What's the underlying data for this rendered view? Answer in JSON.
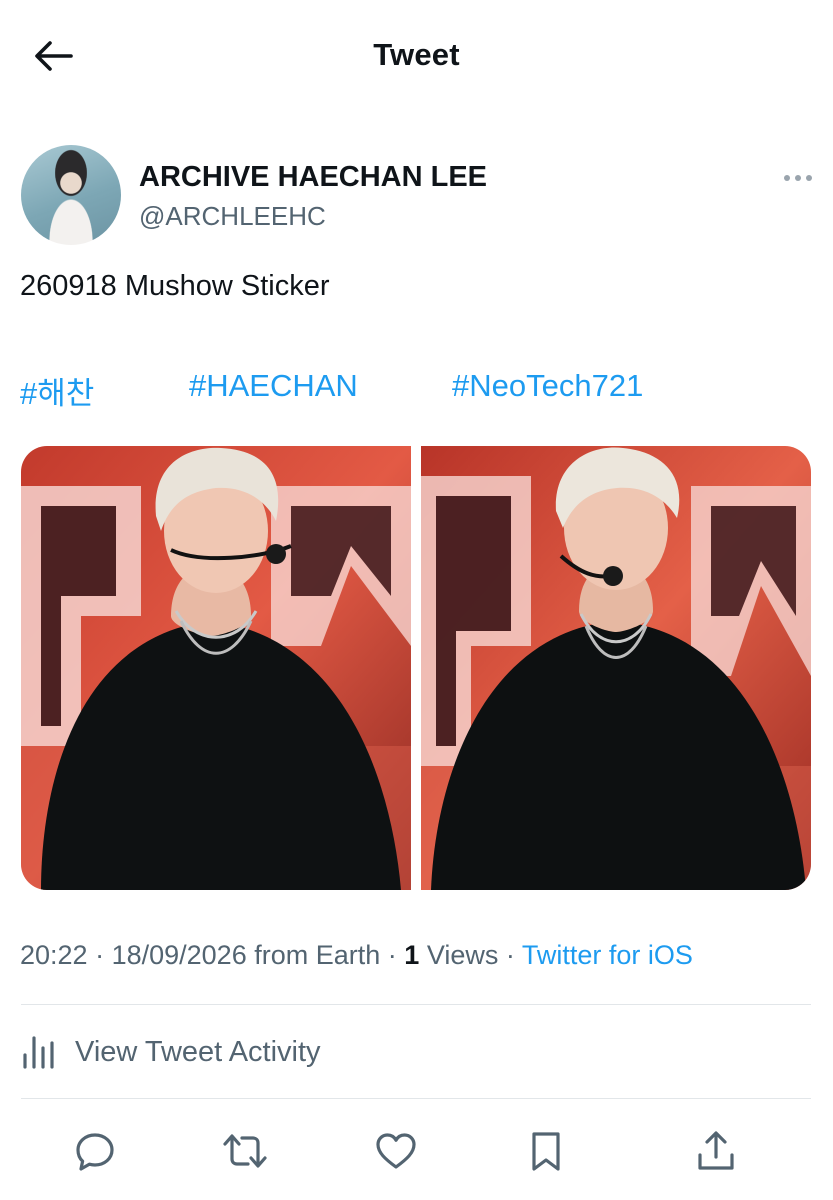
{
  "header": {
    "title": "Tweet",
    "back_icon": "arrow-left-icon"
  },
  "author": {
    "display_name": "ARCHIVE HAECHAN LEE",
    "handle": "@ARCHLEEHC",
    "more_icon": "more-horizontal-icon"
  },
  "tweet": {
    "text": "260918 Mushow Sticker",
    "hashtags": [
      "#해찬",
      "#HAECHAN",
      "#NeoTech721"
    ]
  },
  "media": {
    "count": 2
  },
  "meta": {
    "time": "20:22",
    "date": "18/09/2026",
    "location": "from Earth",
    "views_count": "1",
    "views_label": "Views",
    "source": "Twitter for iOS",
    "sep": " · "
  },
  "activity": {
    "label": "View Tweet Activity",
    "icon": "bar-chart-icon"
  },
  "actions": [
    "reply-icon",
    "retweet-icon",
    "like-icon",
    "bookmark-icon",
    "share-icon"
  ],
  "colors": {
    "accent": "#1d9bf0",
    "text": "#0f1419",
    "muted": "#536471",
    "divider": "#e2e6e9"
  }
}
